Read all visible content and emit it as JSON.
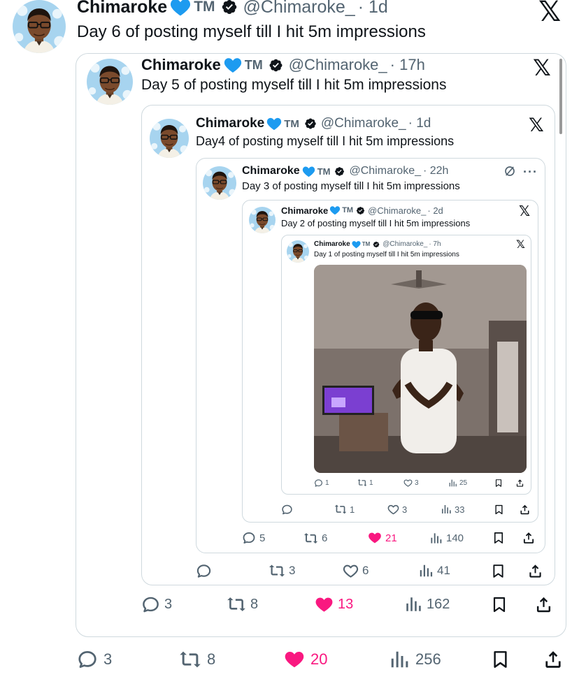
{
  "tweets": [
    {
      "name": "Chimaroke",
      "badge": "TM",
      "handle": "@Chimaroke_",
      "time": "· 1d",
      "text": "Day 6 of posting myself till I hit 5m impressions",
      "replies": "3",
      "reposts": "8",
      "likes": "20",
      "views": "256",
      "liked": true
    },
    {
      "name": "Chimaroke",
      "badge": "TM",
      "handle": "@Chimaroke_",
      "time": "· 17h",
      "text": "Day 5 of posting myself till I hit 5m impressions",
      "replies": "3",
      "reposts": "8",
      "likes": "13",
      "views": "162",
      "liked": true
    },
    {
      "name": "Chimaroke",
      "badge": "TM",
      "handle": "@Chimaroke_",
      "time": "· 1d",
      "text": "Day4 of posting myself till I hit 5m impressions",
      "replies": "",
      "reposts": "3",
      "likes": "6",
      "views": "41",
      "liked": false
    },
    {
      "name": "Chimaroke",
      "badge": "TM",
      "handle": "@Chimaroke_",
      "time": "· 22h",
      "text": "Day 3 of posting myself till I hit 5m impressions",
      "replies": "5",
      "reposts": "6",
      "likes": "21",
      "views": "140",
      "liked": true
    },
    {
      "name": "Chimaroke",
      "badge": "TM",
      "handle": "@Chimaroke_",
      "time": "· 2d",
      "text": "Day 2 of posting myself till I hit 5m impressions",
      "replies": "",
      "reposts": "1",
      "likes": "3",
      "views": "33",
      "liked": false
    },
    {
      "name": "Chimaroke",
      "badge": "TM",
      "handle": "@Chimaroke_",
      "time": "· 7h",
      "text": "Day 1 of posting myself till I hit 5m impressions",
      "replies": "1",
      "reposts": "1",
      "likes": "3",
      "views": "25",
      "liked": false
    }
  ],
  "icons": {
    "x_logo": "x-logo-icon",
    "verified": "verified-badge-icon",
    "heart_emoji": "blue-heart-icon",
    "reply": "reply-icon",
    "repost": "repost-icon",
    "like": "like-icon",
    "views": "views-icon",
    "bookmark": "bookmark-icon",
    "share": "share-icon",
    "grok": "grok-icon",
    "more": "more-icon"
  },
  "colors": {
    "accent": "#1d9bf0",
    "like": "#f91880",
    "muted": "#536471",
    "border": "#cfd9de"
  }
}
